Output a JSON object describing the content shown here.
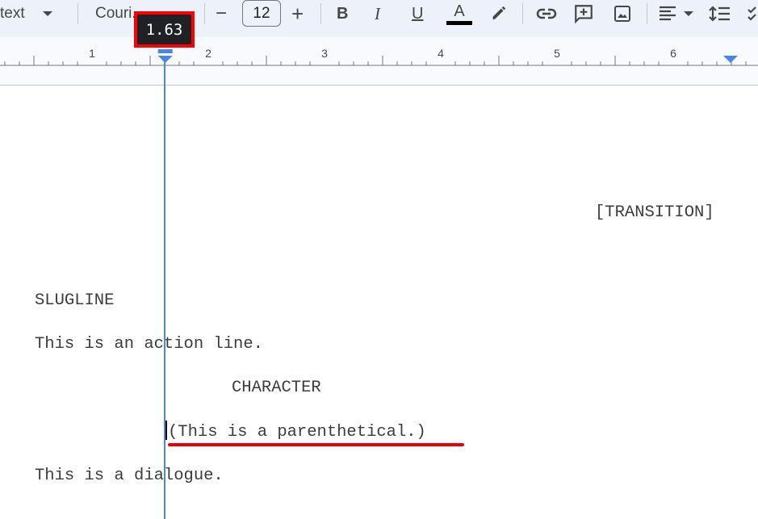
{
  "toolbar": {
    "style_dropdown": "text",
    "font_dropdown": "Courier New",
    "font_dropdown_visible": "Couri...",
    "font_size": "12",
    "decrease_label": "−",
    "increase_label": "+",
    "bold_label": "B",
    "italic_label": "I",
    "underline_label": "U",
    "text_color_label": "A",
    "text_color": "#000000",
    "icons": [
      "bold-icon",
      "italic-icon",
      "underline-icon",
      "text-color-icon",
      "highlighter-icon",
      "link-icon",
      "add-comment-icon",
      "insert-image-icon",
      "align-left-icon",
      "line-spacing-icon",
      "checklist-icon"
    ]
  },
  "ruler": {
    "labels": [
      "1",
      "2",
      "3",
      "4",
      "5",
      "6"
    ],
    "indent_value": "1.63",
    "accent_color": "#4a86e8"
  },
  "document": {
    "lines": {
      "transition": "[TRANSITION]",
      "slugline": "SLUGLINE",
      "action": "This is an action line.",
      "character": "CHARACTER",
      "parenthetical": "(This is a parenthetical.)",
      "dialogue": "This is a dialogue."
    }
  },
  "annotations": {
    "highlight_color": "#ff0000"
  }
}
